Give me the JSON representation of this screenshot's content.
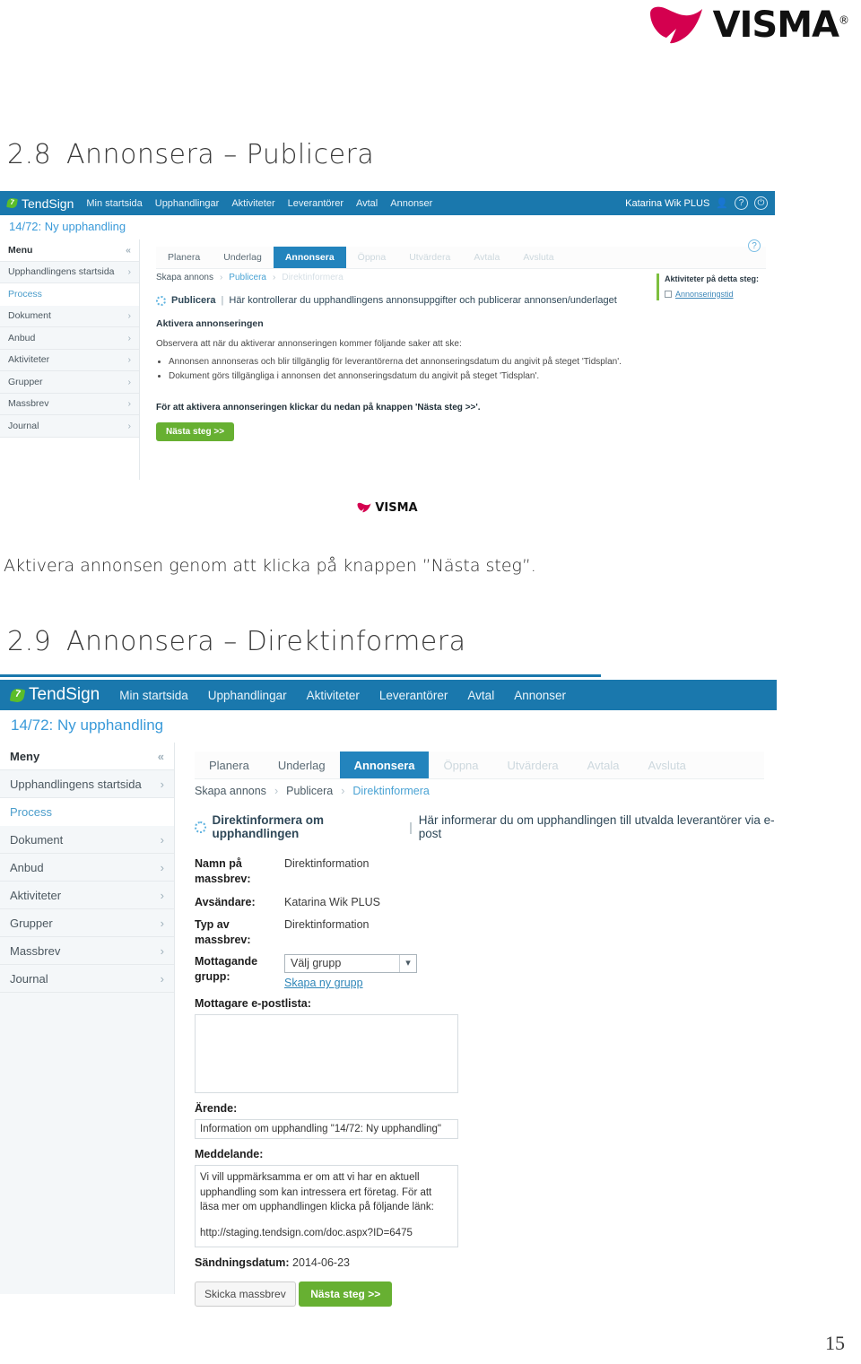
{
  "document": {
    "brand": "VISMA",
    "brand_reg": "®",
    "page_number": "15",
    "brand_color": "#d4004f",
    "accent_blue": "#1a78ad",
    "accent_green": "#67b032"
  },
  "sections": [
    {
      "number": "2.8",
      "title": "Annonsera – Publicera"
    },
    {
      "number": "2.9",
      "title": "Annonsera – Direktinformera"
    }
  ],
  "caption1": "Aktivera annonsen genom att klicka på knappen ”Nästa steg”.",
  "app": {
    "logo_text": "TendSign",
    "logo_icon": "leaf-icon",
    "nav": [
      "Min startsida",
      "Upphandlingar",
      "Aktiviteter",
      "Leverantörer",
      "Avtal",
      "Annonser"
    ],
    "user": "Katarina Wik PLUS",
    "user_icon": "user-gear-icon",
    "help_icon": "question-circle-icon",
    "power_icon": "power-icon",
    "subtitle": "14/72: Ny upphandling",
    "menu": {
      "header": "Menu",
      "header2": "Meny",
      "collapse_icon": "chevron-double-left-icon",
      "items": [
        {
          "label": "Upphandlingens startsida",
          "type": "row"
        },
        {
          "label": "Process",
          "type": "plain"
        },
        {
          "label": "Dokument",
          "type": "row"
        },
        {
          "label": "Anbud",
          "type": "row"
        },
        {
          "label": "Aktiviteter",
          "type": "row"
        },
        {
          "label": "Grupper",
          "type": "row"
        },
        {
          "label": "Massbrev",
          "type": "row"
        },
        {
          "label": "Journal",
          "type": "row"
        }
      ]
    },
    "steps": [
      {
        "label": "Planera",
        "state": "done"
      },
      {
        "label": "Underlag",
        "state": "done"
      },
      {
        "label": "Annonsera",
        "state": "active"
      },
      {
        "label": "Öppna",
        "state": "dim"
      },
      {
        "label": "Utvärdera",
        "state": "dim"
      },
      {
        "label": "Avtala",
        "state": "dim"
      },
      {
        "label": "Avsluta",
        "state": "dim"
      }
    ]
  },
  "shot1": {
    "crumbs": [
      {
        "label": "Skapa annons",
        "state": "done"
      },
      {
        "label": "Publicera",
        "state": "current"
      },
      {
        "label": "Direktinformera",
        "state": "dim"
      }
    ],
    "panel_title": "Publicera",
    "panel_desc": "Här kontrollerar du upphandlingens annonsuppgifter och publicerar annonsen/underlaget",
    "heading": "Aktivera annonseringen",
    "intro": "Observera att när du aktiverar annonseringen kommer följande saker att ske:",
    "bullets": [
      "Annonsen annonseras och blir tillgänglig för leverantörerna det annonseringsdatum du angivit på steget 'Tidsplan'.",
      "Dokument görs tillgängliga i annonsen det annonseringsdatum du angivit på steget 'Tidsplan'."
    ],
    "closing": "För att aktivera annonseringen klickar du nedan på knappen 'Nästa steg >>'.",
    "next_button": "Nästa steg >>",
    "activities_title": "Aktiviteter på detta steg:",
    "activities": [
      "Annonseringstid"
    ],
    "footer_brand": "VISMA"
  },
  "shot2": {
    "crumbs": [
      {
        "label": "Skapa annons",
        "state": "done"
      },
      {
        "label": "Publicera",
        "state": "done"
      },
      {
        "label": "Direktinformera",
        "state": "current"
      }
    ],
    "panel_title": "Direktinformera om upphandlingen",
    "panel_desc": "Här informerar du om upphandlingen till utvalda leverantörer via e-post",
    "form": {
      "name_label": "Namn på massbrev:",
      "name_value": "Direktinformation",
      "sender_label": "Avsändare:",
      "sender_value": "Katarina Wik PLUS",
      "type_label": "Typ av massbrev:",
      "type_value": "Direktinformation",
      "group_label": "Mottagande grupp:",
      "group_value": "Välj grupp",
      "group_link": "Skapa ny grupp",
      "maillist_label": "Mottagare e-postlista:",
      "maillist_value": "",
      "subject_label": "Ärende:",
      "subject_value": "Information om upphandling \"14/72: Ny upphandling\"",
      "message_label": "Meddelande:",
      "message_value": "Vi vill uppmärksamma er om att vi har en aktuell upphandling som kan intressera ert företag. För att läsa mer om upphandlingen klicka på följande länk:",
      "message_link": "http://staging.tendsign.com/doc.aspx?ID=6475",
      "senddate_label": "Sändningsdatum:",
      "senddate_value": "2014-06-23",
      "send_button": "Skicka massbrev",
      "next_button": "Nästa steg >>"
    }
  }
}
